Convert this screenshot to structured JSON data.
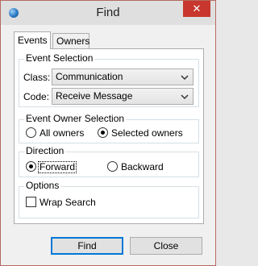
{
  "window": {
    "title": "Find",
    "close_glyph": "✕"
  },
  "tabs": [
    {
      "label": "Events",
      "active": true
    },
    {
      "label": "Owners",
      "active": false
    }
  ],
  "event_selection": {
    "legend": "Event Selection",
    "class_label": "Class:",
    "class_value": "Communication",
    "code_label": "Code:",
    "code_value": "Receive Message"
  },
  "owner_selection": {
    "legend": "Event Owner Selection",
    "options": [
      {
        "label": "All owners",
        "selected": false
      },
      {
        "label": "Selected owners",
        "selected": true
      }
    ]
  },
  "direction": {
    "legend": "Direction",
    "options": [
      {
        "label": "Forward",
        "selected": true
      },
      {
        "label": "Backward",
        "selected": false
      }
    ]
  },
  "options": {
    "legend": "Options",
    "wrap_search_label": "Wrap Search",
    "wrap_search_checked": false
  },
  "buttons": {
    "find": "Find",
    "close": "Close"
  },
  "colors": {
    "close_button": "#c7372e",
    "accent": "#0078d7"
  }
}
